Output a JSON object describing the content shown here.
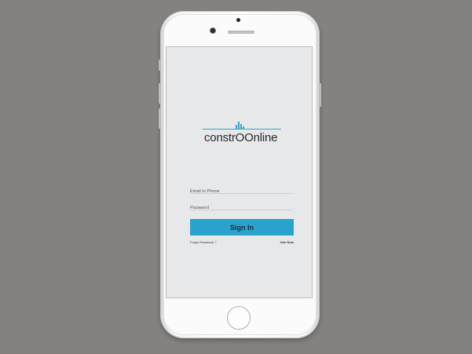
{
  "brand": {
    "name": "constrOOnline",
    "accent_color": "#29a2cc"
  },
  "login": {
    "email_placeholder": "Email or Phone",
    "password_placeholder": "Password",
    "signin_label": "Sign In",
    "forgot_label": "Forgot Password ?",
    "join_label": "Join Now"
  },
  "device": {
    "home_button_icon": "home-button-circle",
    "camera_icon": "front-camera-dot"
  }
}
